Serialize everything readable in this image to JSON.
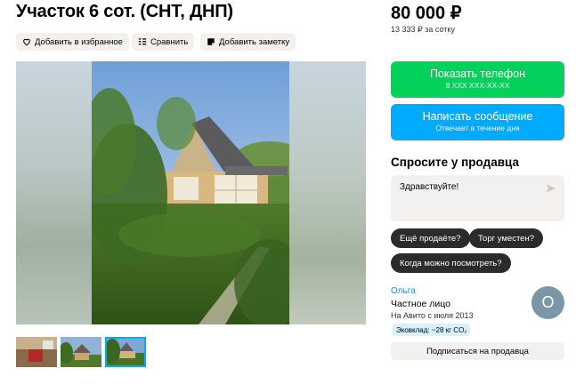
{
  "listing": {
    "title": "Участок 6 сот. (СНТ, ДНП)",
    "price": "80 000 ₽",
    "price_per_unit": "13 333 ₽ за сотку"
  },
  "actions": {
    "favorite": "Добавить в избранное",
    "compare": "Сравнить",
    "note": "Добавить заметку"
  },
  "contact": {
    "phone_label": "Показать телефон",
    "phone_masked": "8 XXX XXX-XX-XX",
    "message_label": "Написать сообщение",
    "message_sub": "Отвечает в течение дня"
  },
  "ask": {
    "title": "Спросите у продавца",
    "input_value": "Здравствуйте!",
    "chips": [
      "Ещё продаёте?",
      "Торг уместен?",
      "Когда можно посмотреть?"
    ]
  },
  "seller": {
    "name": "Ольга",
    "type": "Частное лицо",
    "since": "На Авито с июля 2013",
    "eco": "Эковклад: ~28 кг CO₂",
    "avatar_letter": "О",
    "subscribe": "Подписаться на продавца"
  },
  "gallery": {
    "thumbnails": [
      "interior-photo",
      "house-photo",
      "house-photo-selected"
    ],
    "selected_index": 2
  },
  "colors": {
    "green": "#02d15c",
    "blue": "#00aaff",
    "link": "#0099f7",
    "chip": "#2b2b2b",
    "light_bg": "#f2f1f0"
  }
}
